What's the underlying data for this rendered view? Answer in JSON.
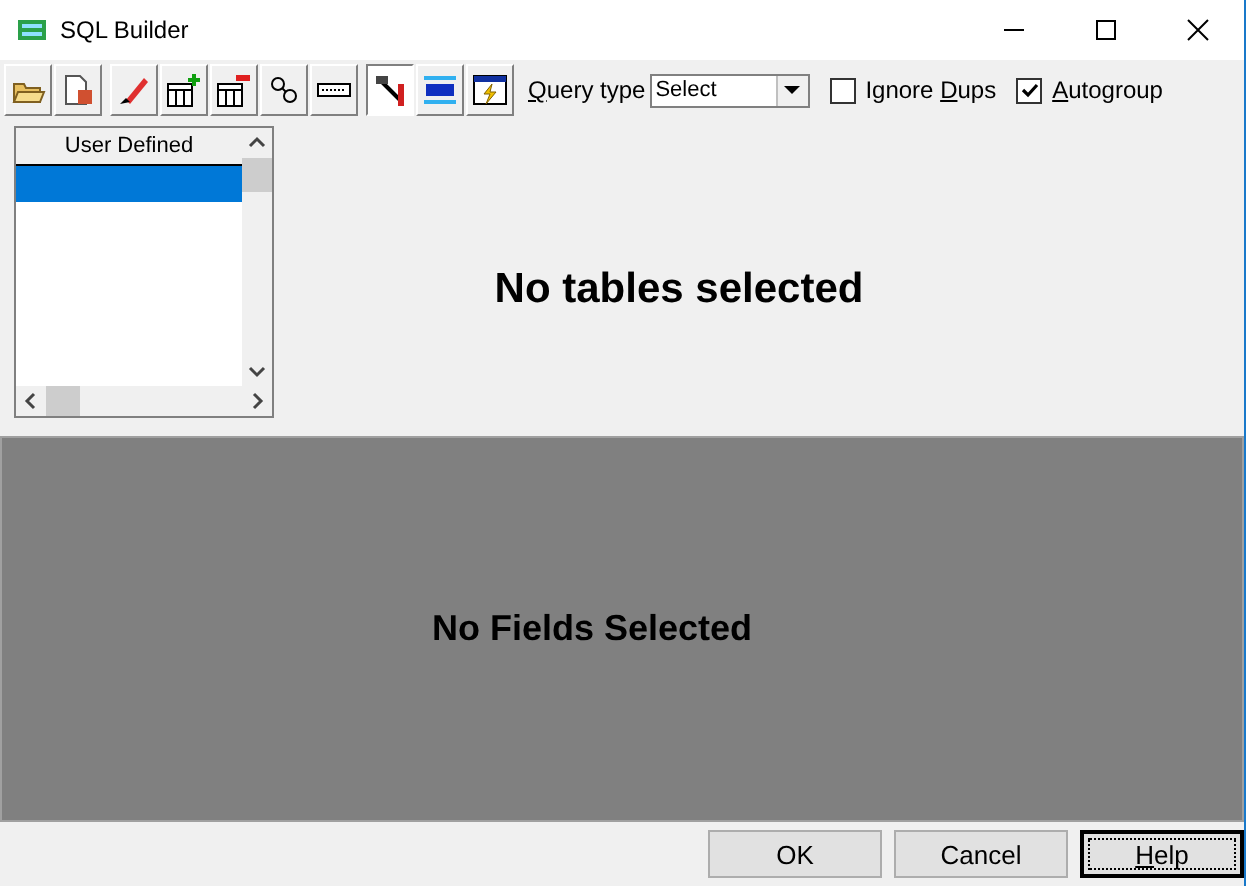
{
  "window": {
    "title": "SQL Builder"
  },
  "toolbar": {
    "groups": [
      {
        "buttons": [
          {
            "kind": "open",
            "pressed": false
          },
          {
            "kind": "save",
            "pressed": false
          }
        ]
      },
      {
        "buttons": [
          {
            "kind": "brush",
            "pressed": false
          },
          {
            "kind": "add-table",
            "pressed": false
          },
          {
            "kind": "remove-table",
            "pressed": false
          },
          {
            "kind": "join",
            "pressed": false
          },
          {
            "kind": "field",
            "pressed": false
          }
        ]
      },
      {
        "buttons": [
          {
            "kind": "tools",
            "pressed": true
          },
          {
            "kind": "sql",
            "pressed": false
          },
          {
            "kind": "run",
            "pressed": false
          }
        ]
      }
    ]
  },
  "query_type": {
    "label": {
      "key": "Q",
      "after": "uery type"
    },
    "value": "Select"
  },
  "checkboxes": [
    {
      "label": {
        "before": "Ignore ",
        "key": "D",
        "after": "ups"
      },
      "checked": false
    },
    {
      "label": {
        "key": "A",
        "after": "utogroup"
      },
      "checked": true
    }
  ],
  "table_list": {
    "header": "User Defined",
    "rows": [
      {
        "selected": true
      }
    ]
  },
  "tables_message": "No tables selected",
  "fields_message": "No Fields Selected",
  "buttons": [
    {
      "label": {
        "before": "OK"
      },
      "focused": false
    },
    {
      "label": {
        "before": "Cancel"
      },
      "focused": false
    },
    {
      "label": {
        "key": "H",
        "after": "elp"
      },
      "focused": true
    }
  ]
}
